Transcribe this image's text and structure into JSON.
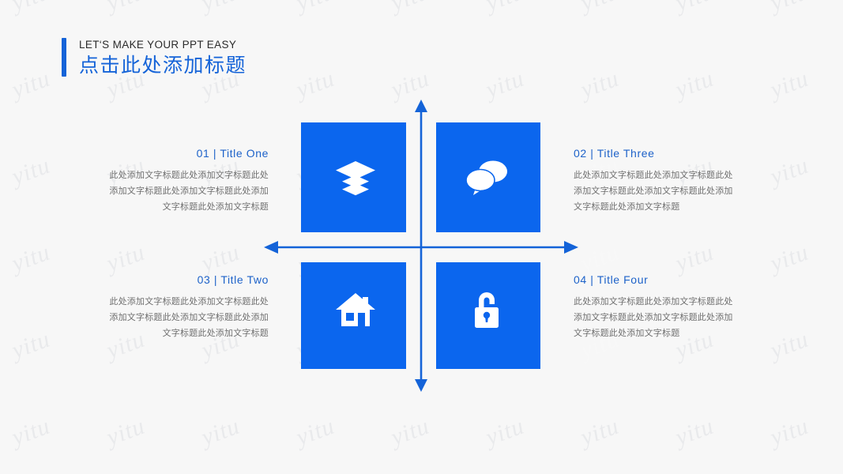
{
  "page": {
    "background_color": "#f7f7f7",
    "accent_color": "#1463d8",
    "tile_color": "#0b66ee",
    "watermark_text": "yitu"
  },
  "header": {
    "kicker": "LET‘S MAKE YOUR PPT EASY",
    "title": "点击此处添加标题",
    "accent_bar_color": "#1463d8"
  },
  "diagram": {
    "name": "four-quadrant-cross-diagram",
    "tiles": [
      {
        "position": "top-left",
        "icon": "layers-icon"
      },
      {
        "position": "top-right",
        "icon": "chat-bubbles-icon"
      },
      {
        "position": "bottom-left",
        "icon": "home-icon"
      },
      {
        "position": "bottom-right",
        "icon": "unlock-icon"
      }
    ],
    "arrows": {
      "vertical": "double-headed-arrow-vertical",
      "horizontal": "double-headed-arrow-horizontal",
      "color": "#1463d8"
    }
  },
  "blocks": [
    {
      "number": "01",
      "separator": "|",
      "title": "Title One",
      "heading": "01  |  Title One",
      "body": "此处添加文字标题此处添加文字标题此处添加文字标题此处添加文字标题此处添加文字标题此处添加文字标题",
      "align": "right"
    },
    {
      "number": "02",
      "separator": "|",
      "title": "Title Three",
      "heading": "02  |  Title Three",
      "body": "此处添加文字标题此处添加文字标题此处添加文字标题此处添加文字标题此处添加文字标题此处添加文字标题",
      "align": "left"
    },
    {
      "number": "03",
      "separator": "|",
      "title": "Title Two",
      "heading": "03  |  Title Two",
      "body": "此处添加文字标题此处添加文字标题此处添加文字标题此处添加文字标题此处添加文字标题此处添加文字标题",
      "align": "right"
    },
    {
      "number": "04",
      "separator": "|",
      "title": "Title Four",
      "heading": "04  |  Title Four",
      "body": "此处添加文字标题此处添加文字标题此处添加文字标题此处添加文字标题此处添加文字标题此处添加文字标题",
      "align": "left"
    }
  ]
}
